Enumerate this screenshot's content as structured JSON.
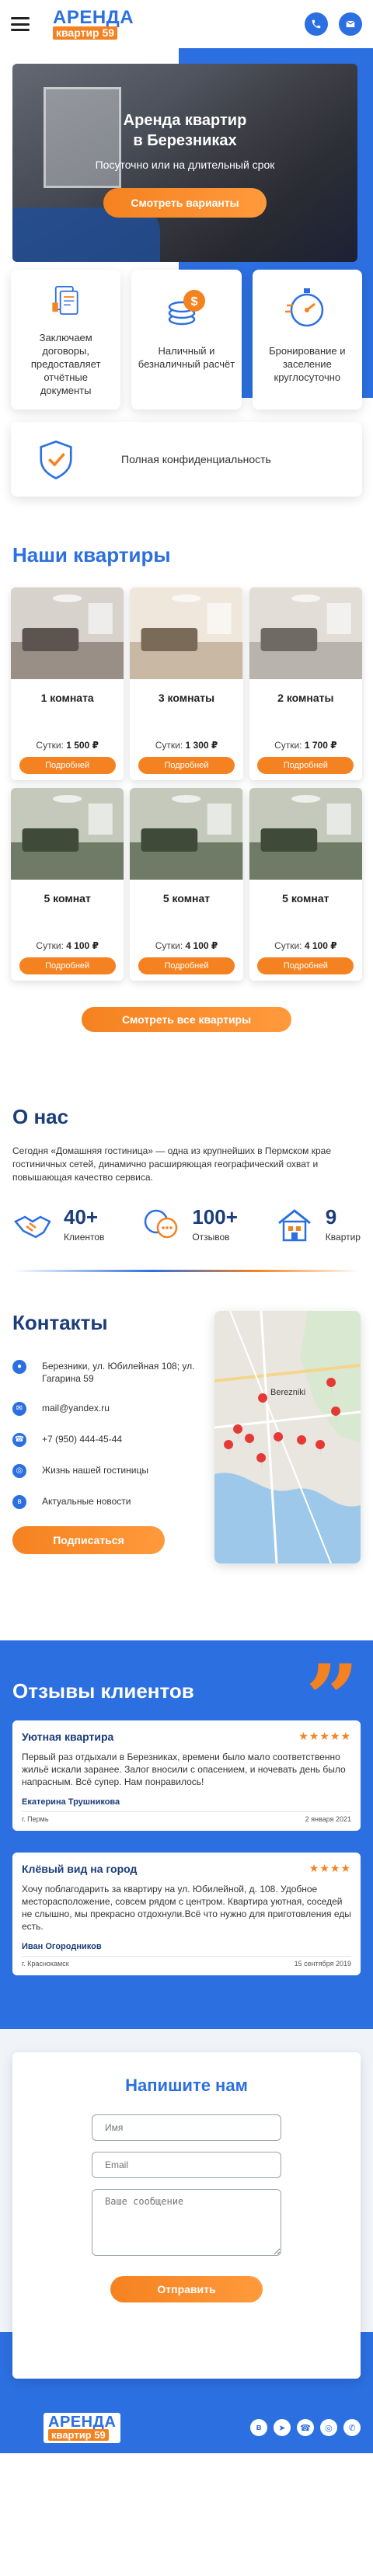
{
  "header": {
    "logo_top": "АРЕНДА",
    "logo_bottom": "квартир 59",
    "phone_icon": "phone-icon",
    "mail_icon": "mail-icon"
  },
  "hero": {
    "title_line1": "Аренда квартир",
    "title_line2": "в Березниках",
    "subtitle": "Посуточно или на длительный срок",
    "button": "Смотреть варианты"
  },
  "features": [
    {
      "icon": "documents-icon",
      "text": "Заключаем договоры, предоставляет отчётные документы"
    },
    {
      "icon": "coins-icon",
      "text": "Наличный и безналичный расчёт"
    },
    {
      "icon": "stopwatch-icon",
      "text": "Бронирование и заселение круглосуточно"
    },
    {
      "icon": "shield-check-icon",
      "text": "Полная конфиденциальность"
    }
  ],
  "apartments": {
    "title": "Наши квартиры",
    "price_label": "Сутки:",
    "button": "Подробней",
    "items": [
      {
        "name": "1 комната",
        "price": "1 500 ₽"
      },
      {
        "name": "3 комнаты",
        "price": "1 300 ₽"
      },
      {
        "name": "2 комнаты",
        "price": "1 700 ₽"
      },
      {
        "name": "5 комнат",
        "price": "4 100 ₽"
      },
      {
        "name": "5 комнат",
        "price": "4 100 ₽"
      },
      {
        "name": "5 комнат",
        "price": "4 100 ₽"
      }
    ],
    "all_button": "Смотреть все квартиры"
  },
  "about": {
    "title": "О нас",
    "text": "Сегодня «Домашняя гостиница» — одна из крупнейших в Пермском крае гостиничных сетей, динамично расширяющая географический охват и повышающая качество сервиса.",
    "stats": [
      {
        "icon": "handshake-icon",
        "num": "40+",
        "label": "Клиентов"
      },
      {
        "icon": "chat-bubbles-icon",
        "num": "100+",
        "label": "Отзывов"
      },
      {
        "icon": "house-icon",
        "num": "9",
        "label": "Квартир"
      }
    ]
  },
  "contacts": {
    "title": "Контакты",
    "items": [
      {
        "icon": "location-icon",
        "text": "Березники, ул. Юбилейная 108; ул. Гагарина 59"
      },
      {
        "icon": "email-icon",
        "text": "mail@yandex.ru"
      },
      {
        "icon": "phone-icon",
        "text": "+7 (950) 444-45-44"
      },
      {
        "icon": "instagram-icon",
        "text": "Жизнь нашей гостиницы"
      },
      {
        "icon": "vk-icon",
        "text": "Актуальные новости"
      }
    ],
    "subscribe": "Подписаться",
    "map_city": "Berezniki"
  },
  "reviews": {
    "title": "Отзывы клиентов",
    "items": [
      {
        "title": "Уютная квартира",
        "stars": "★★★★★",
        "text": "Первый раз отдыхали в Березниках, времени было мало соответственно жильё искали заранее. Залог вносили с опасением, и ночевать день было напрасным. Всё супер. Нам понравилось!",
        "author": "Екатерина Трушникова",
        "city": "г. Пермь",
        "date": "2 января 2021"
      },
      {
        "title": "Клёвый вид на город",
        "stars": "★★★★",
        "text": "Хочу поблагодарить за квартиру на ул. Юбилейной, д. 108. Удобное месторасположение, совсем рядом с центром. Квартира уютная, соседей не слышно, мы прекрасно отдохнули.Всё что нужно для приготовления еды есть.",
        "author": "Иван Огородников",
        "city": "г. Краснокамск",
        "date": "15 сентября 2019"
      }
    ]
  },
  "contact_form": {
    "title": "Напишите нам",
    "name_placeholder": "Имя",
    "email_placeholder": "Email",
    "message_placeholder": "Ваше сообщение",
    "button": "Отправить"
  },
  "footer": {
    "logo_top": "АРЕНДА",
    "logo_bottom": "квартир 59",
    "socials": [
      "vk-icon",
      "telegram-icon",
      "viber-icon",
      "instagram-icon",
      "whatsapp-icon"
    ]
  },
  "colors": {
    "primary": "#2c6fe0",
    "accent": "#f58220",
    "dark": "#1b3d7a"
  }
}
